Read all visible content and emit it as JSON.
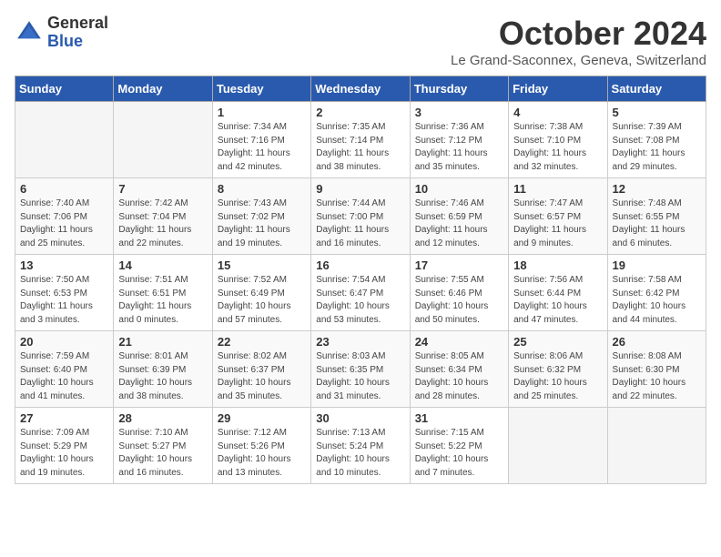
{
  "logo": {
    "general": "General",
    "blue": "Blue"
  },
  "header": {
    "month": "October 2024",
    "location": "Le Grand-Saconnex, Geneva, Switzerland"
  },
  "weekdays": [
    "Sunday",
    "Monday",
    "Tuesday",
    "Wednesday",
    "Thursday",
    "Friday",
    "Saturday"
  ],
  "weeks": [
    [
      {
        "day": "",
        "sunrise": "",
        "sunset": "",
        "daylight": ""
      },
      {
        "day": "",
        "sunrise": "",
        "sunset": "",
        "daylight": ""
      },
      {
        "day": "1",
        "sunrise": "Sunrise: 7:34 AM",
        "sunset": "Sunset: 7:16 PM",
        "daylight": "Daylight: 11 hours and 42 minutes."
      },
      {
        "day": "2",
        "sunrise": "Sunrise: 7:35 AM",
        "sunset": "Sunset: 7:14 PM",
        "daylight": "Daylight: 11 hours and 38 minutes."
      },
      {
        "day": "3",
        "sunrise": "Sunrise: 7:36 AM",
        "sunset": "Sunset: 7:12 PM",
        "daylight": "Daylight: 11 hours and 35 minutes."
      },
      {
        "day": "4",
        "sunrise": "Sunrise: 7:38 AM",
        "sunset": "Sunset: 7:10 PM",
        "daylight": "Daylight: 11 hours and 32 minutes."
      },
      {
        "day": "5",
        "sunrise": "Sunrise: 7:39 AM",
        "sunset": "Sunset: 7:08 PM",
        "daylight": "Daylight: 11 hours and 29 minutes."
      }
    ],
    [
      {
        "day": "6",
        "sunrise": "Sunrise: 7:40 AM",
        "sunset": "Sunset: 7:06 PM",
        "daylight": "Daylight: 11 hours and 25 minutes."
      },
      {
        "day": "7",
        "sunrise": "Sunrise: 7:42 AM",
        "sunset": "Sunset: 7:04 PM",
        "daylight": "Daylight: 11 hours and 22 minutes."
      },
      {
        "day": "8",
        "sunrise": "Sunrise: 7:43 AM",
        "sunset": "Sunset: 7:02 PM",
        "daylight": "Daylight: 11 hours and 19 minutes."
      },
      {
        "day": "9",
        "sunrise": "Sunrise: 7:44 AM",
        "sunset": "Sunset: 7:00 PM",
        "daylight": "Daylight: 11 hours and 16 minutes."
      },
      {
        "day": "10",
        "sunrise": "Sunrise: 7:46 AM",
        "sunset": "Sunset: 6:59 PM",
        "daylight": "Daylight: 11 hours and 12 minutes."
      },
      {
        "day": "11",
        "sunrise": "Sunrise: 7:47 AM",
        "sunset": "Sunset: 6:57 PM",
        "daylight": "Daylight: 11 hours and 9 minutes."
      },
      {
        "day": "12",
        "sunrise": "Sunrise: 7:48 AM",
        "sunset": "Sunset: 6:55 PM",
        "daylight": "Daylight: 11 hours and 6 minutes."
      }
    ],
    [
      {
        "day": "13",
        "sunrise": "Sunrise: 7:50 AM",
        "sunset": "Sunset: 6:53 PM",
        "daylight": "Daylight: 11 hours and 3 minutes."
      },
      {
        "day": "14",
        "sunrise": "Sunrise: 7:51 AM",
        "sunset": "Sunset: 6:51 PM",
        "daylight": "Daylight: 11 hours and 0 minutes."
      },
      {
        "day": "15",
        "sunrise": "Sunrise: 7:52 AM",
        "sunset": "Sunset: 6:49 PM",
        "daylight": "Daylight: 10 hours and 57 minutes."
      },
      {
        "day": "16",
        "sunrise": "Sunrise: 7:54 AM",
        "sunset": "Sunset: 6:47 PM",
        "daylight": "Daylight: 10 hours and 53 minutes."
      },
      {
        "day": "17",
        "sunrise": "Sunrise: 7:55 AM",
        "sunset": "Sunset: 6:46 PM",
        "daylight": "Daylight: 10 hours and 50 minutes."
      },
      {
        "day": "18",
        "sunrise": "Sunrise: 7:56 AM",
        "sunset": "Sunset: 6:44 PM",
        "daylight": "Daylight: 10 hours and 47 minutes."
      },
      {
        "day": "19",
        "sunrise": "Sunrise: 7:58 AM",
        "sunset": "Sunset: 6:42 PM",
        "daylight": "Daylight: 10 hours and 44 minutes."
      }
    ],
    [
      {
        "day": "20",
        "sunrise": "Sunrise: 7:59 AM",
        "sunset": "Sunset: 6:40 PM",
        "daylight": "Daylight: 10 hours and 41 minutes."
      },
      {
        "day": "21",
        "sunrise": "Sunrise: 8:01 AM",
        "sunset": "Sunset: 6:39 PM",
        "daylight": "Daylight: 10 hours and 38 minutes."
      },
      {
        "day": "22",
        "sunrise": "Sunrise: 8:02 AM",
        "sunset": "Sunset: 6:37 PM",
        "daylight": "Daylight: 10 hours and 35 minutes."
      },
      {
        "day": "23",
        "sunrise": "Sunrise: 8:03 AM",
        "sunset": "Sunset: 6:35 PM",
        "daylight": "Daylight: 10 hours and 31 minutes."
      },
      {
        "day": "24",
        "sunrise": "Sunrise: 8:05 AM",
        "sunset": "Sunset: 6:34 PM",
        "daylight": "Daylight: 10 hours and 28 minutes."
      },
      {
        "day": "25",
        "sunrise": "Sunrise: 8:06 AM",
        "sunset": "Sunset: 6:32 PM",
        "daylight": "Daylight: 10 hours and 25 minutes."
      },
      {
        "day": "26",
        "sunrise": "Sunrise: 8:08 AM",
        "sunset": "Sunset: 6:30 PM",
        "daylight": "Daylight: 10 hours and 22 minutes."
      }
    ],
    [
      {
        "day": "27",
        "sunrise": "Sunrise: 7:09 AM",
        "sunset": "Sunset: 5:29 PM",
        "daylight": "Daylight: 10 hours and 19 minutes."
      },
      {
        "day": "28",
        "sunrise": "Sunrise: 7:10 AM",
        "sunset": "Sunset: 5:27 PM",
        "daylight": "Daylight: 10 hours and 16 minutes."
      },
      {
        "day": "29",
        "sunrise": "Sunrise: 7:12 AM",
        "sunset": "Sunset: 5:26 PM",
        "daylight": "Daylight: 10 hours and 13 minutes."
      },
      {
        "day": "30",
        "sunrise": "Sunrise: 7:13 AM",
        "sunset": "Sunset: 5:24 PM",
        "daylight": "Daylight: 10 hours and 10 minutes."
      },
      {
        "day": "31",
        "sunrise": "Sunrise: 7:15 AM",
        "sunset": "Sunset: 5:22 PM",
        "daylight": "Daylight: 10 hours and 7 minutes."
      },
      {
        "day": "",
        "sunrise": "",
        "sunset": "",
        "daylight": ""
      },
      {
        "day": "",
        "sunrise": "",
        "sunset": "",
        "daylight": ""
      }
    ]
  ]
}
